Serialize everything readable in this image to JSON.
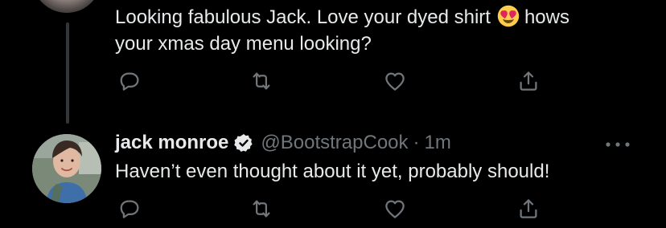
{
  "thread": {
    "reply_to_tweet": {
      "text_line1_before_emoji": "Looking fabulous Jack. Love your dyed shirt",
      "emoji": "heart-eyes-emoji",
      "text_line1_after_emoji": "hows",
      "text_line2": "your xmas day menu looking?"
    },
    "reply_tweet": {
      "display_name": "jack monroe",
      "handle": "@BootstrapCook",
      "separator": "·",
      "time": "1m",
      "text": "Haven’t even thought about it yet, probably should!"
    }
  },
  "icons": {
    "reply": "reply-icon",
    "retweet": "retweet-icon",
    "like": "heart-icon",
    "share": "share-icon",
    "verified": "verified-badge-icon",
    "more": "more-options-icon"
  },
  "colors": {
    "background": "#000000",
    "text": "#e7e9ea",
    "muted": "#71767b",
    "thread_line": "#333639"
  }
}
